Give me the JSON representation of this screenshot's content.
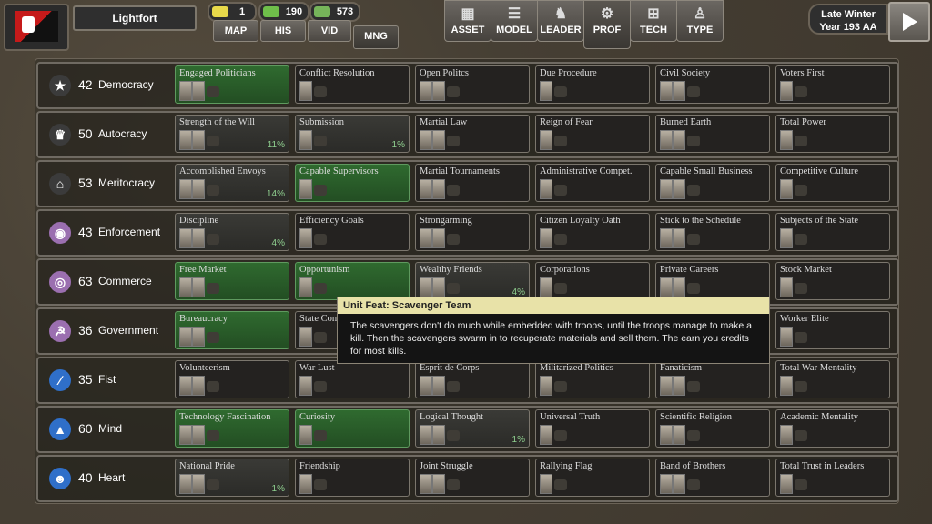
{
  "header": {
    "nation": "Lightfort",
    "resources": [
      {
        "name": "sun-icon",
        "value": "1",
        "color": "#e8d94a"
      },
      {
        "name": "fist-icon",
        "value": "190",
        "color": "#6fbf4a"
      },
      {
        "name": "money-icon",
        "value": "573",
        "color": "#76b45a"
      }
    ],
    "nav": [
      "MAP",
      "HIS",
      "VID",
      "MNG"
    ],
    "nav_active": "MNG",
    "tabs": [
      {
        "label": "ASSET",
        "icon": "building-icon"
      },
      {
        "label": "MODEL",
        "icon": "sliders-icon"
      },
      {
        "label": "LEADER",
        "icon": "strongman-icon"
      },
      {
        "label": "PROF",
        "icon": "cogs-icon"
      },
      {
        "label": "TECH",
        "icon": "tree-icon"
      },
      {
        "label": "TYPE",
        "icon": "soldier-icon"
      }
    ],
    "tab_active": "PROF",
    "season_line1": "Late Winter",
    "season_line2": "Year 193 AA"
  },
  "rows": [
    {
      "num": "42",
      "name": "Democracy",
      "icon": "star-icon",
      "icon_color": "#3b3b3b",
      "cards": [
        {
          "name": "Engaged Politicians",
          "state": "done",
          "pct": ""
        },
        {
          "name": "Conflict Resolution",
          "state": "none",
          "pct": ""
        },
        {
          "name": "Open Politcs",
          "state": "none",
          "pct": ""
        },
        {
          "name": "Due Procedure",
          "state": "none",
          "pct": ""
        },
        {
          "name": "Civil Society",
          "state": "none",
          "pct": ""
        },
        {
          "name": "Voters First",
          "state": "none",
          "pct": ""
        }
      ]
    },
    {
      "num": "50",
      "name": "Autocracy",
      "icon": "crown-icon",
      "icon_color": "#3b3b3b",
      "cards": [
        {
          "name": "Strength of the Will",
          "state": "part",
          "pct": "11%"
        },
        {
          "name": "Submission",
          "state": "part",
          "pct": "1%"
        },
        {
          "name": "Martial Law",
          "state": "none",
          "pct": ""
        },
        {
          "name": "Reign of Fear",
          "state": "none",
          "pct": ""
        },
        {
          "name": "Burned Earth",
          "state": "none",
          "pct": ""
        },
        {
          "name": "Total Power",
          "state": "none",
          "pct": ""
        }
      ]
    },
    {
      "num": "53",
      "name": "Meritocracy",
      "icon": "bank-icon",
      "icon_color": "#3b3b3b",
      "cards": [
        {
          "name": "Accomplished Envoys",
          "state": "part",
          "pct": "14%"
        },
        {
          "name": "Capable Supervisors",
          "state": "done",
          "pct": ""
        },
        {
          "name": "Martial Tournaments",
          "state": "none",
          "pct": ""
        },
        {
          "name": "Administrative Compet.",
          "state": "none",
          "pct": ""
        },
        {
          "name": "Capable Small Business",
          "state": "none",
          "pct": ""
        },
        {
          "name": "Competitive Culture",
          "state": "none",
          "pct": ""
        }
      ]
    },
    {
      "num": "43",
      "name": "Enforcement",
      "icon": "eye-icon",
      "icon_color": "#9b6fb0",
      "cards": [
        {
          "name": "Discipline",
          "state": "part",
          "pct": "4%"
        },
        {
          "name": "Efficiency Goals",
          "state": "none",
          "pct": ""
        },
        {
          "name": "Strongarming",
          "state": "none",
          "pct": ""
        },
        {
          "name": "Citizen Loyalty Oath",
          "state": "none",
          "pct": ""
        },
        {
          "name": "Stick to the Schedule",
          "state": "none",
          "pct": ""
        },
        {
          "name": "Subjects of the State",
          "state": "none",
          "pct": ""
        }
      ]
    },
    {
      "num": "63",
      "name": "Commerce",
      "icon": "coins-icon",
      "icon_color": "#9b6fb0",
      "cards": [
        {
          "name": "Free Market",
          "state": "done",
          "pct": ""
        },
        {
          "name": "Opportunism",
          "state": "done",
          "pct": ""
        },
        {
          "name": "Wealthy Friends",
          "state": "part",
          "pct": "4%"
        },
        {
          "name": "Corporations",
          "state": "none",
          "pct": ""
        },
        {
          "name": "Private Careers",
          "state": "none",
          "pct": ""
        },
        {
          "name": "Stock Market",
          "state": "none",
          "pct": ""
        }
      ]
    },
    {
      "num": "36",
      "name": "Government",
      "icon": "hammer-sickle-icon",
      "icon_color": "#9b6fb0",
      "cards": [
        {
          "name": "Bureaucracy",
          "state": "done",
          "pct": ""
        },
        {
          "name": "State Con",
          "state": "none",
          "pct": ""
        },
        {
          "name": "",
          "state": "none",
          "pct": ""
        },
        {
          "name": "",
          "state": "none",
          "pct": ""
        },
        {
          "name": "",
          "state": "none",
          "pct": ""
        },
        {
          "name": "Worker Elite",
          "state": "none",
          "pct": ""
        }
      ]
    },
    {
      "num": "35",
      "name": "Fist",
      "icon": "blade-icon",
      "icon_color": "#2f6fc9",
      "cards": [
        {
          "name": "Volunteerism",
          "state": "none",
          "pct": ""
        },
        {
          "name": "War Lust",
          "state": "none",
          "pct": ""
        },
        {
          "name": "Esprit de Corps",
          "state": "none",
          "pct": ""
        },
        {
          "name": "Militarized Politics",
          "state": "none",
          "pct": ""
        },
        {
          "name": "Fanaticism",
          "state": "none",
          "pct": ""
        },
        {
          "name": "Total War Mentality",
          "state": "none",
          "pct": ""
        }
      ]
    },
    {
      "num": "60",
      "name": "Mind",
      "icon": "graduation-cap-icon",
      "icon_color": "#2f6fc9",
      "cards": [
        {
          "name": "Technology Fascination",
          "state": "done",
          "pct": ""
        },
        {
          "name": "Curiosity",
          "state": "done",
          "pct": ""
        },
        {
          "name": "Logical Thought",
          "state": "part",
          "pct": "1%"
        },
        {
          "name": "Universal Truth",
          "state": "none",
          "pct": ""
        },
        {
          "name": "Scientific Religion",
          "state": "none",
          "pct": ""
        },
        {
          "name": "Academic Mentality",
          "state": "none",
          "pct": ""
        }
      ]
    },
    {
      "num": "40",
      "name": "Heart",
      "icon": "people-icon",
      "icon_color": "#2f6fc9",
      "cards": [
        {
          "name": "National Pride",
          "state": "part",
          "pct": "1%"
        },
        {
          "name": "Friendship",
          "state": "none",
          "pct": ""
        },
        {
          "name": "Joint Struggle",
          "state": "none",
          "pct": ""
        },
        {
          "name": "Rallying Flag",
          "state": "none",
          "pct": ""
        },
        {
          "name": "Band of Brothers",
          "state": "none",
          "pct": ""
        },
        {
          "name": "Total Trust in Leaders",
          "state": "none",
          "pct": ""
        }
      ]
    }
  ],
  "tooltip": {
    "title": "Unit Feat: Scavenger Team",
    "body": "The scavengers don't do much while embedded with troops, until the troops manage to make a kill. Then the scavengers swarm in to recuperate materials and sell them. The earn you credits for most kills."
  }
}
